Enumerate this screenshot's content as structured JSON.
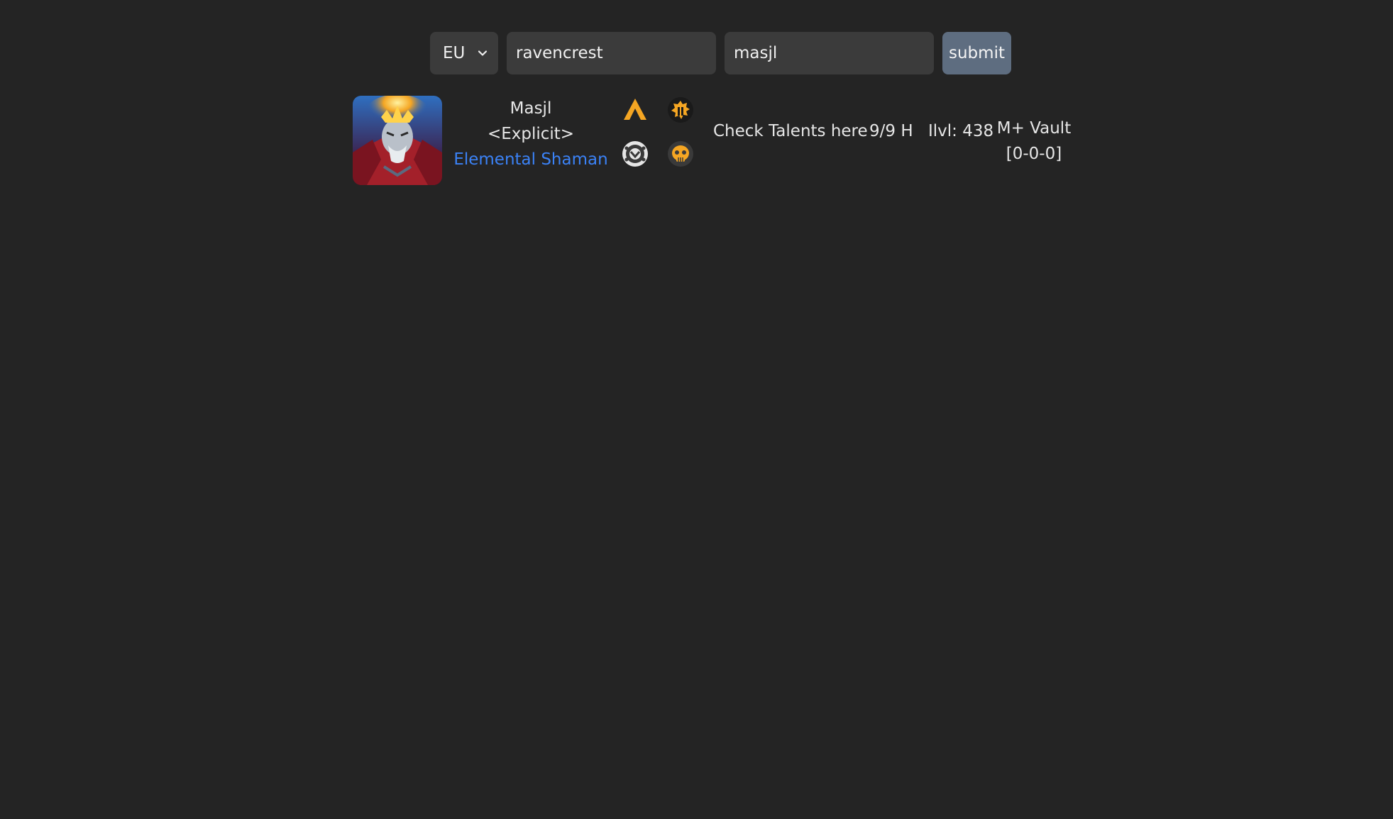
{
  "search": {
    "region": "EU",
    "realm": "ravencrest",
    "character": "masjl",
    "submit_label": "submit"
  },
  "character": {
    "name": "Masjl",
    "guild": "<Explicit>",
    "spec_class": "Elemental Shaman",
    "talents_link": "Check Talents here",
    "raid_progress": "9/9 H",
    "item_level": "Ilvl: 438",
    "vault_label": "M+ Vault",
    "vault_value": "[0-0-0]"
  },
  "colors": {
    "background": "#242424",
    "field_bg": "#3b3b3b",
    "submit_bg": "#5e6d80",
    "spec_link": "#3b82f6",
    "icon_orange": "#f5a623"
  },
  "icons": [
    "warcraftlogs-icon",
    "raiderio-icon",
    "wowhead-icon",
    "checkpvp-icon"
  ]
}
